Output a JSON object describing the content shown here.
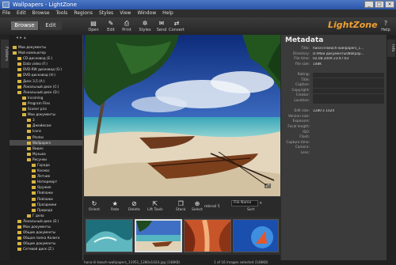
{
  "window": {
    "title": "Wallpapers - LightZone"
  },
  "menu": [
    "File",
    "Edit",
    "Browse",
    "Tools",
    "Regions",
    "Styles",
    "View",
    "Window",
    "Help"
  ],
  "toolbar": {
    "modes": [
      "Browse",
      "Edit"
    ],
    "buttons": [
      {
        "label": "Open",
        "icon": "open-icon",
        "glyph": "▤"
      },
      {
        "label": "Edit",
        "icon": "edit-icon",
        "glyph": "✎"
      },
      {
        "label": "Print",
        "icon": "print-icon",
        "glyph": "⎙"
      },
      {
        "label": "Styles",
        "icon": "styles-icon",
        "glyph": "✲"
      },
      {
        "label": "Send",
        "icon": "send-icon",
        "glyph": "✉"
      },
      {
        "label": "Convert",
        "icon": "convert-icon",
        "glyph": "⇄"
      }
    ],
    "brand": "LightZone",
    "help": "Help"
  },
  "side_tabs": {
    "left": "Folders",
    "right": "Info"
  },
  "folder_tree": [
    {
      "label": "Мои документы",
      "depth": 0
    },
    {
      "label": "Мой компьютер",
      "depth": 0
    },
    {
      "label": "CD-дисковод (E:)",
      "depth": 1
    },
    {
      "label": "Data video (F:)",
      "depth": 1
    },
    {
      "label": "DVD-RW дисковод (G:)",
      "depth": 1
    },
    {
      "label": "DVD-дисковод (H:)",
      "depth": 1
    },
    {
      "label": "Диск 3,5 (A:)",
      "depth": 1
    },
    {
      "label": "Локальный диск (C:)",
      "depth": 1
    },
    {
      "label": "Локальный диск (D:)",
      "depth": 1
    },
    {
      "label": "Incoming",
      "depth": 2
    },
    {
      "label": "Program Files",
      "depth": 2
    },
    {
      "label": "Scaner pics",
      "depth": 2
    },
    {
      "label": "Мои документы",
      "depth": 2
    },
    {
      "label": "3",
      "depth": 3
    },
    {
      "label": "Джеймсом",
      "depth": 3
    },
    {
      "label": "Icons",
      "depth": 3
    },
    {
      "label": "Photos",
      "depth": 3
    },
    {
      "label": "Wallpapers",
      "depth": 3,
      "selected": true
    },
    {
      "label": "Видео",
      "depth": 3
    },
    {
      "label": "Музыка",
      "depth": 3
    },
    {
      "label": "Рисунки",
      "depth": 3
    },
    {
      "label": "Города",
      "depth": 4
    },
    {
      "label": "Космос",
      "depth": 4
    },
    {
      "label": "Летние",
      "depth": 4
    },
    {
      "label": "Натюрморт",
      "depth": 4
    },
    {
      "label": "Оружие",
      "depth": 4
    },
    {
      "label": "Пейзажи",
      "depth": 4
    },
    {
      "label": "Пейзажи",
      "depth": 4
    },
    {
      "label": "Праздники",
      "depth": 4
    },
    {
      "label": "Природа",
      "depth": 4
    },
    {
      "label": "Г дела",
      "depth": 3
    },
    {
      "label": "Локальный диск (E:)",
      "depth": 1
    },
    {
      "label": "Мои документы",
      "depth": 1
    },
    {
      "label": "Общие документы",
      "depth": 1
    },
    {
      "label": "Общая папка Колиго",
      "depth": 1
    },
    {
      "label": "Общие документы",
      "depth": 1
    },
    {
      "label": "Сетевой диск (Z:)",
      "depth": 1
    }
  ],
  "controls": {
    "buttons": [
      {
        "label": "Orient",
        "icon": "rotate-icon",
        "glyph": "↻"
      },
      {
        "label": "Rate",
        "icon": "star-icon",
        "glyph": "★"
      },
      {
        "label": "Delete",
        "icon": "delete-icon",
        "glyph": "⊘"
      },
      {
        "label": "Lift Tools",
        "icon": "lift-icon",
        "glyph": "⇱"
      },
      {
        "label": "Stack",
        "icon": "stack-icon",
        "glyph": "❐"
      },
      {
        "label": "Select",
        "icon": "select-icon",
        "glyph": "⊕"
      }
    ],
    "size_label": "mbnail 5",
    "sort_value": "File Name",
    "sort_label": "Sort"
  },
  "status": {
    "file": "hana-ili-beach-wallpapers_11951_1280x1024.jpg (148KB)",
    "count": "1 of 16 images selected (148KB)"
  },
  "metadata": {
    "title": "Metadata",
    "fields": [
      {
        "label": "Title:",
        "value": "hana-ili-beach-wallpapers_1..."
      },
      {
        "label": "Directory:",
        "value": "D:\\Мои документы\\Wallpap..."
      },
      {
        "label": "File time:",
        "value": "02.08.2009 23:47:03"
      },
      {
        "label": "File size:",
        "value": "148K"
      },
      {
        "label": "",
        "value": ""
      },
      {
        "label": "Rating:",
        "value": "",
        "editable": true
      },
      {
        "label": "Title:",
        "value": "",
        "editable": true
      },
      {
        "label": "Caption:",
        "value": "",
        "editable": true
      },
      {
        "label": "Copyright:",
        "value": "",
        "editable": true
      },
      {
        "label": "Creator:",
        "value": "",
        "editable": true
      },
      {
        "label": "Location:",
        "value": "",
        "editable": true
      },
      {
        "label": "",
        "value": ""
      },
      {
        "label": "Edit size:",
        "value": "1280 x 1024"
      },
      {
        "label": "Version size:",
        "value": ""
      },
      {
        "label": "Exposure:",
        "value": ""
      },
      {
        "label": "Focal length:",
        "value": ""
      },
      {
        "label": "ISO:",
        "value": ""
      },
      {
        "label": "Flash:",
        "value": ""
      },
      {
        "label": "Capture time:",
        "value": ""
      },
      {
        "label": "Camera:",
        "value": ""
      },
      {
        "label": "Lens:",
        "value": ""
      }
    ]
  }
}
